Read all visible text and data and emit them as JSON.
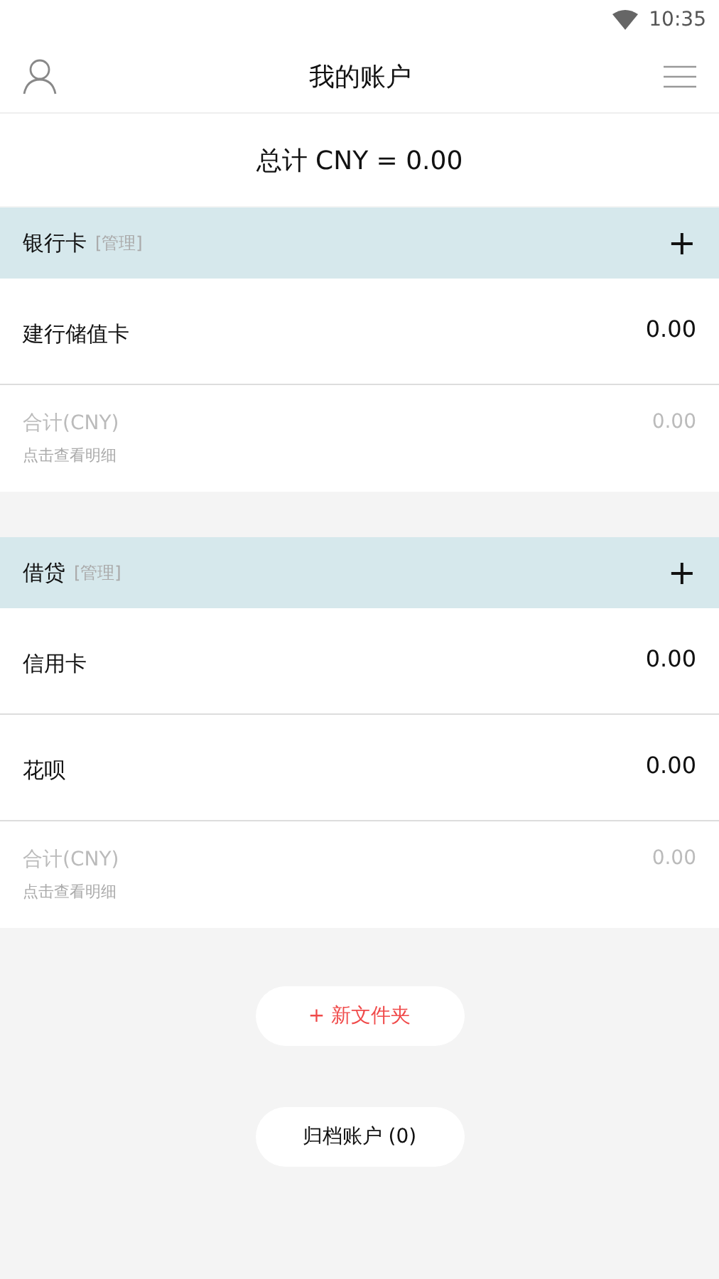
{
  "status_bar": {
    "time": "10:35"
  },
  "header": {
    "title": "我的账户"
  },
  "total": "总计 CNY = 0.00",
  "sections": [
    {
      "title": "银行卡",
      "manage": "[管理]",
      "add": "+",
      "accounts": [
        {
          "name": "建行储值卡",
          "amount": "0.00"
        }
      ],
      "subtotal": {
        "label": "合计(CNY)",
        "amount": "0.00",
        "hint": "点击查看明细"
      }
    },
    {
      "title": "借贷",
      "manage": "[管理]",
      "add": "+",
      "accounts": [
        {
          "name": "信用卡",
          "amount": "0.00"
        },
        {
          "name": "花呗",
          "amount": "0.00"
        }
      ],
      "subtotal": {
        "label": "合计(CNY)",
        "amount": "0.00",
        "hint": "点击查看明细"
      }
    }
  ],
  "buttons": [
    {
      "label": "+ 新文件夹",
      "kind": "accent"
    },
    {
      "label": "归档账户 (0)",
      "kind": "plain"
    }
  ]
}
